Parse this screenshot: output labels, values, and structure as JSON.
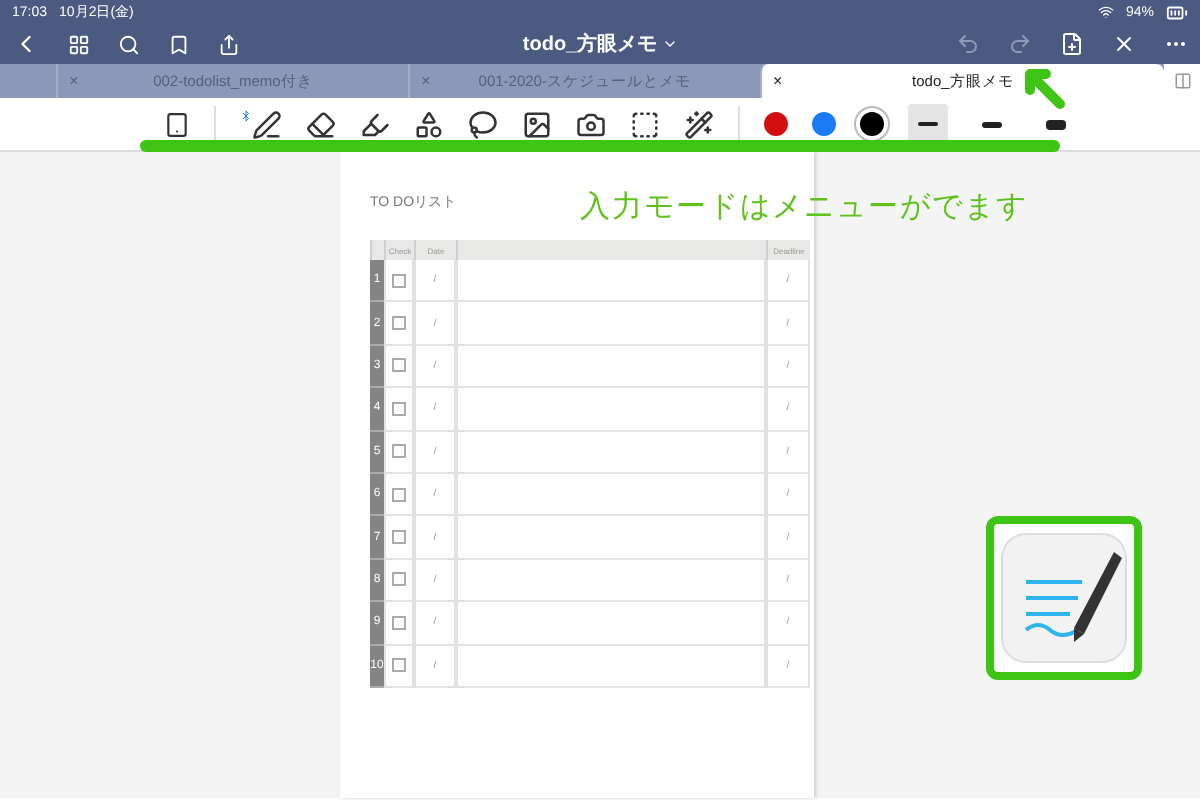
{
  "status_bar": {
    "time": "17:03",
    "date": "10月2日(金)",
    "battery": "94%"
  },
  "nav": {
    "title": "todo_方眼メモ"
  },
  "tabs": [
    {
      "label": "002-todolist_memo付き",
      "close": "×",
      "selected": false
    },
    {
      "label": "001-2020-スケジュールとメモ",
      "close": "×",
      "selected": false
    },
    {
      "label": "todo_方眼メモ",
      "close": "×",
      "selected": true
    }
  ],
  "toolbar": {
    "colors": [
      {
        "color": "#d40f0f",
        "selected": false
      },
      {
        "color": "#1a7cf5",
        "selected": false
      },
      {
        "color": "#000000",
        "selected": true
      }
    ],
    "widths": [
      {
        "selected": true
      },
      {
        "selected": false
      },
      {
        "selected": false
      }
    ]
  },
  "page": {
    "title": "TO DOリスト",
    "columns": [
      "Check",
      "Date",
      "Deadline"
    ],
    "rows": [
      {
        "number": "1",
        "date": "/",
        "deadline": "/",
        "checked": false
      },
      {
        "number": "2",
        "date": "/",
        "deadline": "/",
        "checked": false
      },
      {
        "number": "3",
        "date": "/",
        "deadline": "/",
        "checked": false
      },
      {
        "number": "4",
        "date": "/",
        "deadline": "/",
        "checked": false
      },
      {
        "number": "5",
        "date": "/",
        "deadline": "/",
        "checked": false
      },
      {
        "number": "6",
        "date": "/",
        "deadline": "/",
        "checked": false
      },
      {
        "number": "7",
        "date": "/",
        "deadline": "/",
        "checked": false
      },
      {
        "number": "8",
        "date": "/",
        "deadline": "/",
        "checked": false
      },
      {
        "number": "9",
        "date": "/",
        "deadline": "/",
        "checked": false
      },
      {
        "number": "10",
        "date": "/",
        "deadline": "/",
        "checked": false
      }
    ]
  },
  "annotation": {
    "text": "入力モードはメニューがでます"
  }
}
